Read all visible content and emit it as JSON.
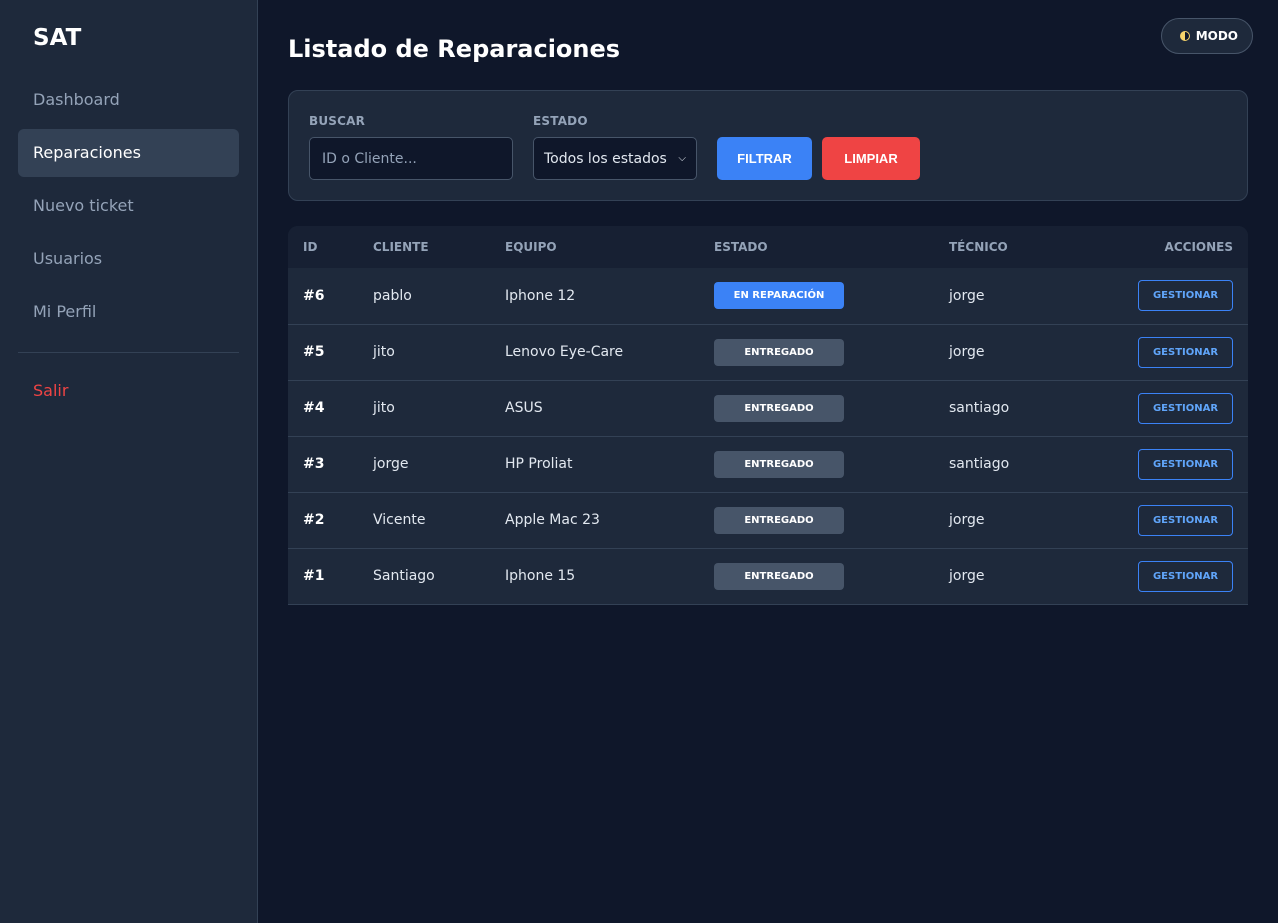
{
  "sidebar": {
    "brand": "SAT",
    "items": [
      {
        "label": "Dashboard"
      },
      {
        "label": "Reparaciones"
      },
      {
        "label": "Nuevo ticket"
      },
      {
        "label": "Usuarios"
      },
      {
        "label": "Mi Perfil"
      }
    ],
    "logout_label": "Salir"
  },
  "header": {
    "title": "Listado de Reparaciones",
    "mode_label": "MODO"
  },
  "filters": {
    "search_label": "BUSCAR",
    "search_placeholder": "ID o Cliente...",
    "search_value": "",
    "status_label": "ESTADO",
    "status_selected": "Todos los estados",
    "filter_button": "FILTRAR",
    "clear_button": "LIMPIAR"
  },
  "table": {
    "headers": [
      "ID",
      "CLIENTE",
      "EQUIPO",
      "ESTADO",
      "TÉCNICO",
      "ACCIONES"
    ],
    "action_label": "GESTIONAR",
    "rows": [
      {
        "id": "#6",
        "cliente": "pablo",
        "equipo": "Iphone 12",
        "estado": "EN REPARACIÓN",
        "tecnico": "jorge"
      },
      {
        "id": "#5",
        "cliente": "jito",
        "equipo": "Lenovo Eye-Care",
        "estado": "ENTREGADO",
        "tecnico": "jorge"
      },
      {
        "id": "#4",
        "cliente": "jito",
        "equipo": "ASUS",
        "estado": "ENTREGADO",
        "tecnico": "santiago"
      },
      {
        "id": "#3",
        "cliente": "jorge",
        "equipo": "HP Proliat",
        "estado": "ENTREGADO",
        "tecnico": "santiago"
      },
      {
        "id": "#2",
        "cliente": "Vicente",
        "equipo": "Apple Mac 23",
        "estado": "ENTREGADO",
        "tecnico": "jorge"
      },
      {
        "id": "#1",
        "cliente": "Santiago",
        "equipo": "Iphone 15",
        "estado": "ENTREGADO",
        "tecnico": "jorge"
      }
    ]
  },
  "colors": {
    "background": "#0f172a",
    "sidebar": "#1e293b",
    "accent_blue": "#3b82f6",
    "danger_red": "#ef4444",
    "badge_delivered": "#475569"
  },
  "icons": {
    "mode": "half-moon-icon",
    "select": "chevron-down-icon"
  }
}
